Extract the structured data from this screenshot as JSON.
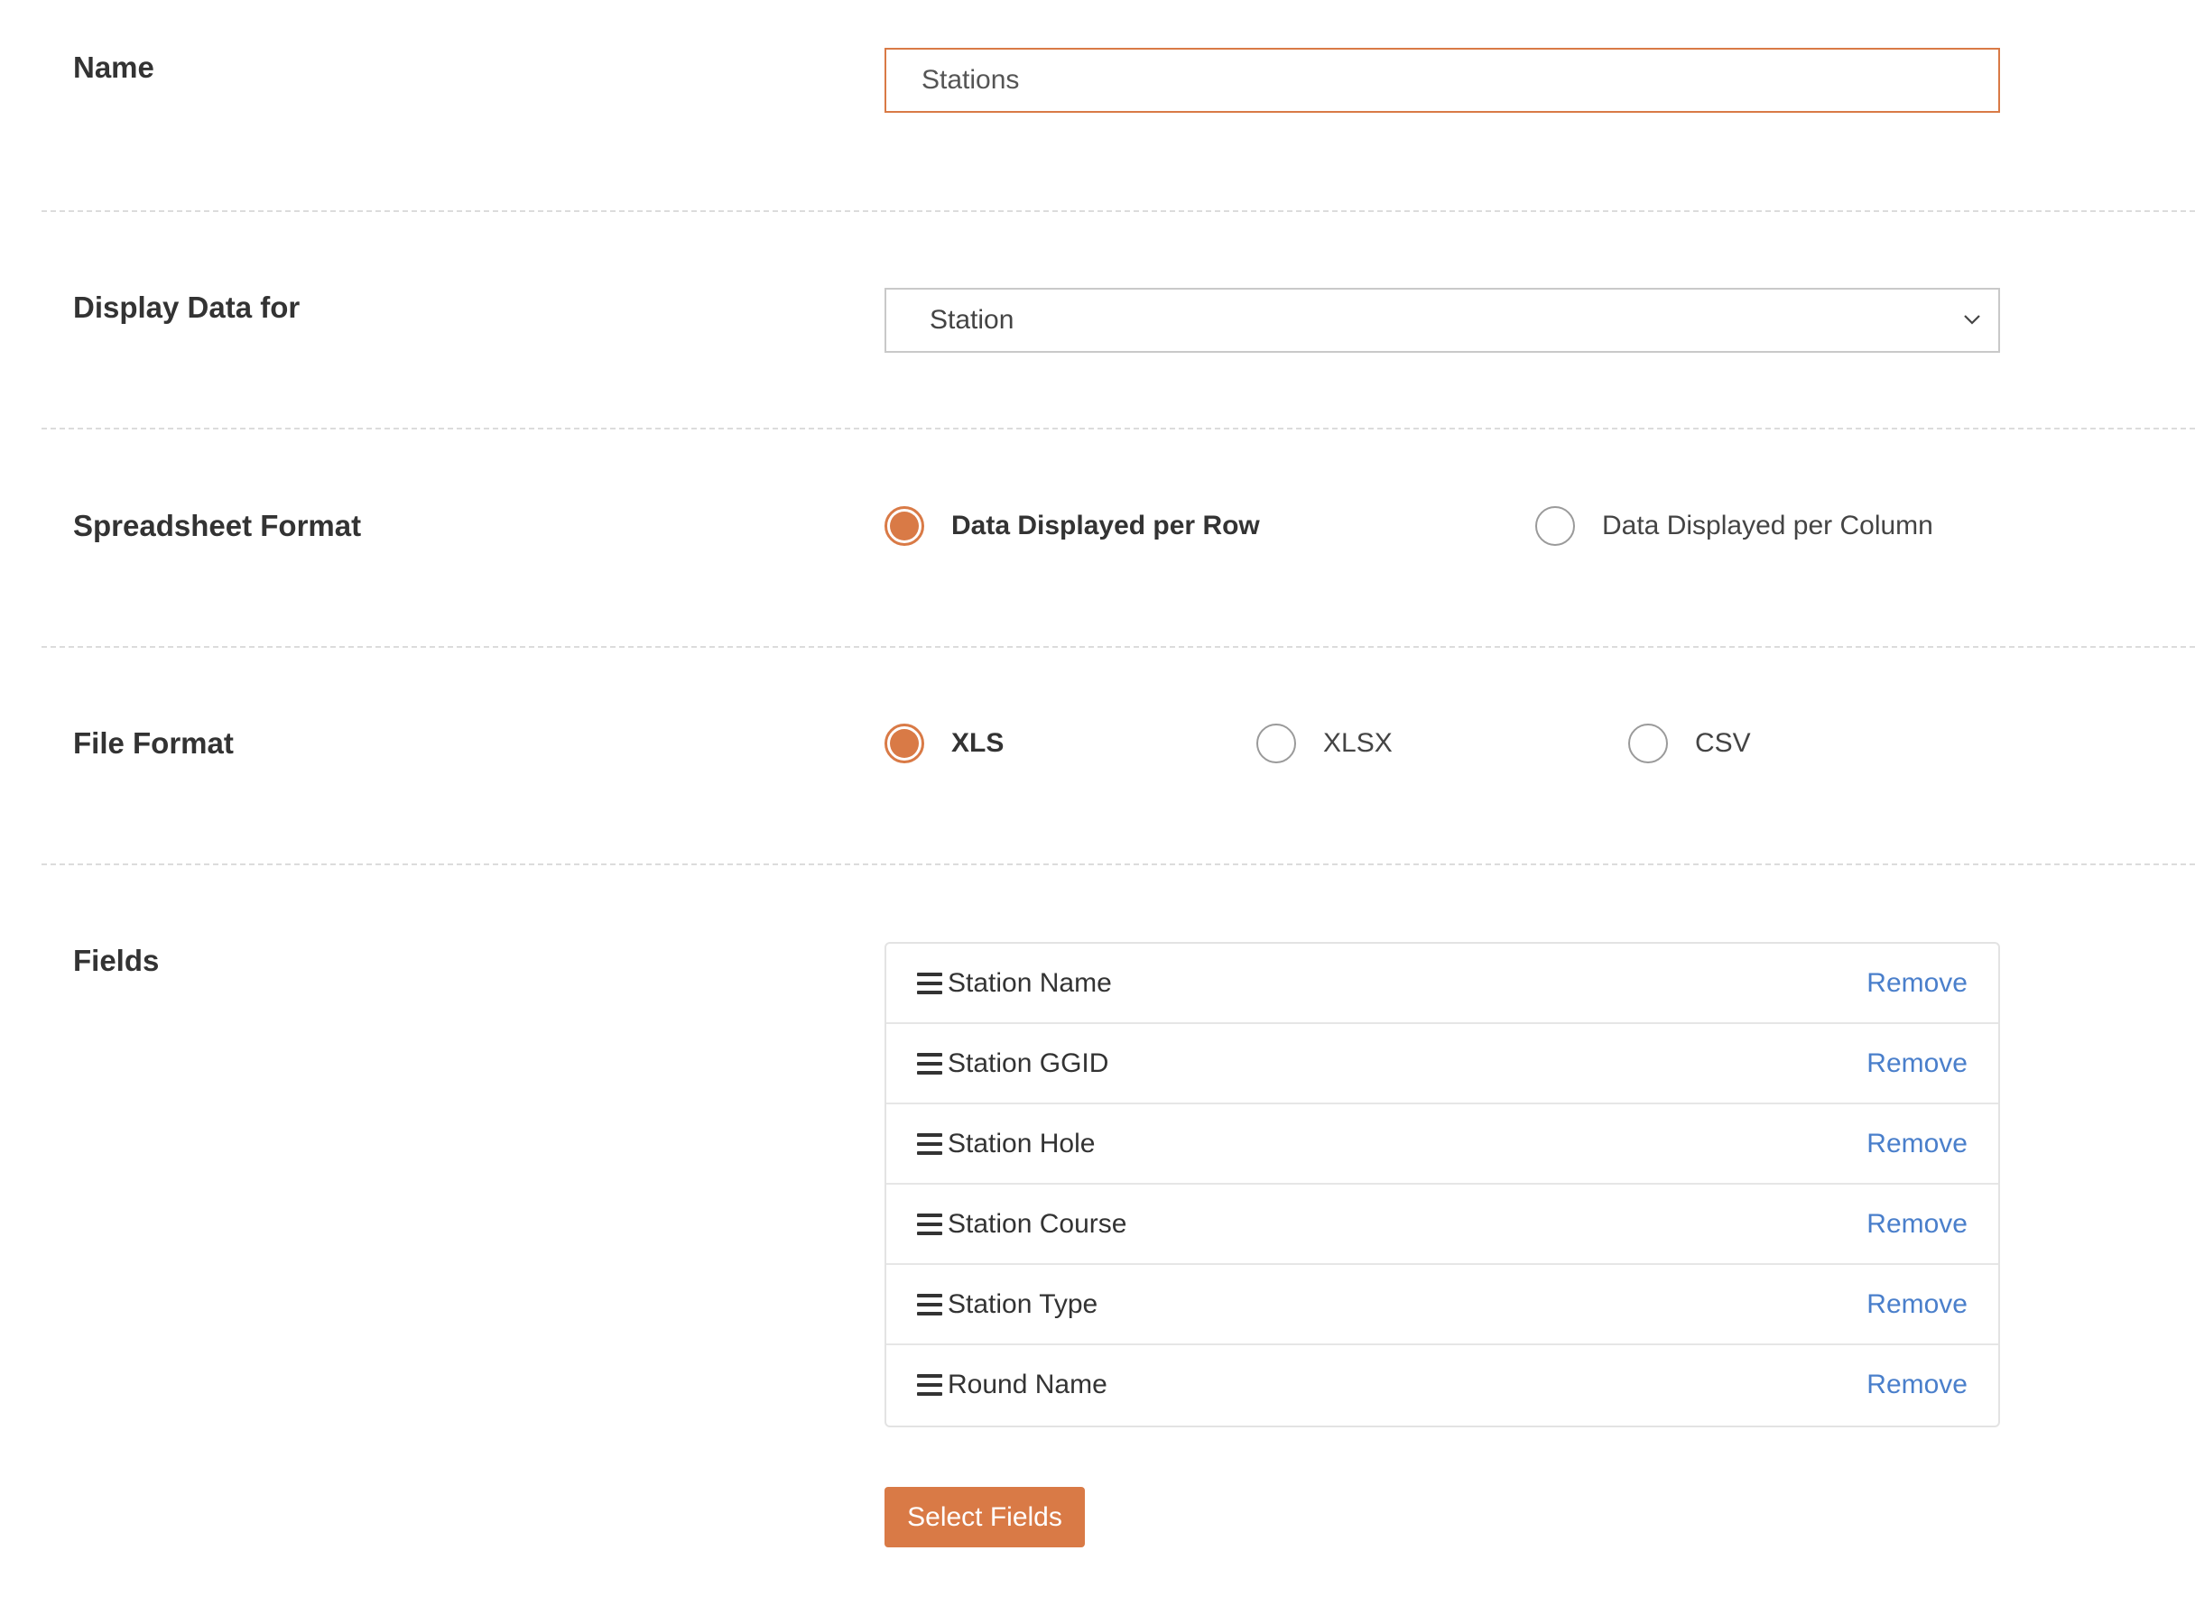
{
  "name_row": {
    "label": "Name",
    "value": "Stations"
  },
  "display_row": {
    "label": "Display Data for",
    "selected": "Station"
  },
  "spreadsheet_row": {
    "label": "Spreadsheet Format",
    "options": [
      {
        "label": "Data Displayed per Row",
        "checked": true
      },
      {
        "label": "Data Displayed per Column",
        "checked": false
      }
    ]
  },
  "file_row": {
    "label": "File Format",
    "options": [
      {
        "label": "XLS",
        "checked": true
      },
      {
        "label": "XLSX",
        "checked": false
      },
      {
        "label": "CSV",
        "checked": false
      }
    ]
  },
  "fields_row": {
    "label": "Fields",
    "remove_label": "Remove",
    "items": [
      {
        "name": "Station Name"
      },
      {
        "name": "Station GGID"
      },
      {
        "name": "Station Hole"
      },
      {
        "name": "Station Course"
      },
      {
        "name": "Station Type"
      },
      {
        "name": "Round Name"
      }
    ],
    "select_button": "Select Fields"
  },
  "colors": {
    "accent": "#d97a46",
    "link": "#4a7fcb"
  },
  "icons": {
    "drag": "drag-handle-icon",
    "dropdown": "chevron-down-icon"
  }
}
